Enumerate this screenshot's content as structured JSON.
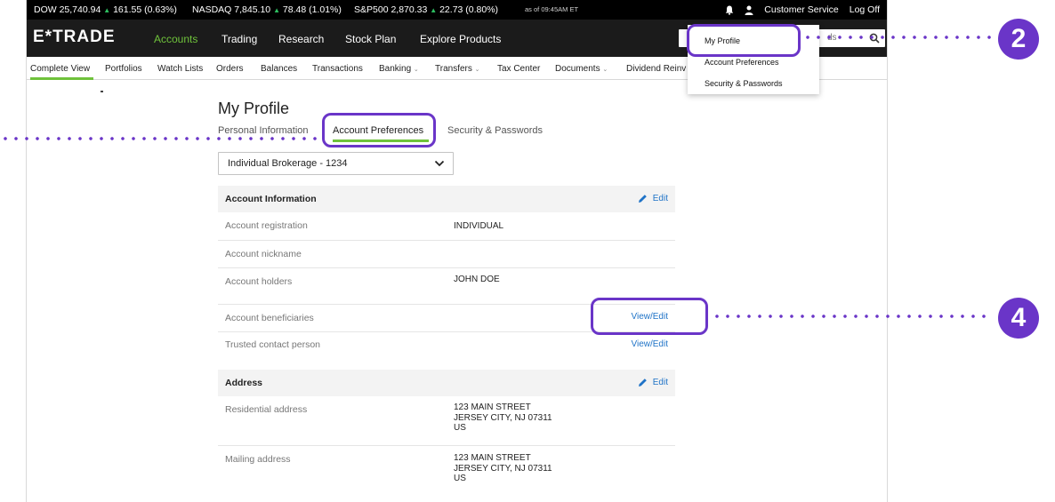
{
  "ticker": {
    "dow": "DOW 25,740.94",
    "dow_change": "161.55 (0.63%)",
    "nasdaq": "NASDAQ 7,845.10",
    "nasdaq_change": "78.48 (1.01%)",
    "sp500": "S&P500 2,870.33",
    "sp500_change": "22.73 (0.80%)",
    "as_of": "as of 09:45AM ET",
    "customer_service": "Customer Service",
    "log_off": "Log Off"
  },
  "main_nav": {
    "logo": "E*TRADE",
    "items": [
      "Accounts",
      "Trading",
      "Research",
      "Stock Plan",
      "Explore Products"
    ],
    "search_hint": "ds"
  },
  "sub_nav": {
    "items": [
      "Complete View",
      "Portfolios",
      "Watch Lists",
      "Orders",
      "Balances",
      "Transactions",
      "Banking",
      "Transfers",
      "Tax Center",
      "Documents",
      "Dividend Reinv"
    ]
  },
  "dropdown": {
    "items": [
      "My Profile",
      "Account Preferences",
      "Security & Passwords"
    ]
  },
  "profile": {
    "title": "My Profile",
    "tabs": [
      "Personal Information",
      "Account Preferences",
      "Security & Passwords"
    ],
    "account_select": "Individual Brokerage - 1234"
  },
  "account_info": {
    "title": "Account Information",
    "edit": "Edit",
    "rows": [
      {
        "label": "Account registration",
        "value": "INDIVIDUAL"
      },
      {
        "label": "Account nickname",
        "value": ""
      },
      {
        "label": "Account holders",
        "value": "JOHN DOE"
      },
      {
        "label": "Account beneficiaries",
        "link": "View/Edit"
      },
      {
        "label": "Trusted contact person",
        "link": "View/Edit"
      }
    ]
  },
  "address": {
    "title": "Address",
    "edit": "Edit",
    "rows": [
      {
        "label": "Residential address",
        "line1": "123 MAIN STREET",
        "line2": "JERSEY CITY, NJ 07311",
        "line3": "US"
      },
      {
        "label": "Mailing address",
        "line1": "123 MAIN STREET",
        "line2": "JERSEY CITY, NJ 07311",
        "line3": "US"
      }
    ]
  },
  "annotations": {
    "step_a": "2",
    "step_b": "4"
  },
  "colors": {
    "accent_green": "#6fc23b",
    "annotation_purple": "#6a35c8",
    "link_blue": "#1f73c7"
  }
}
